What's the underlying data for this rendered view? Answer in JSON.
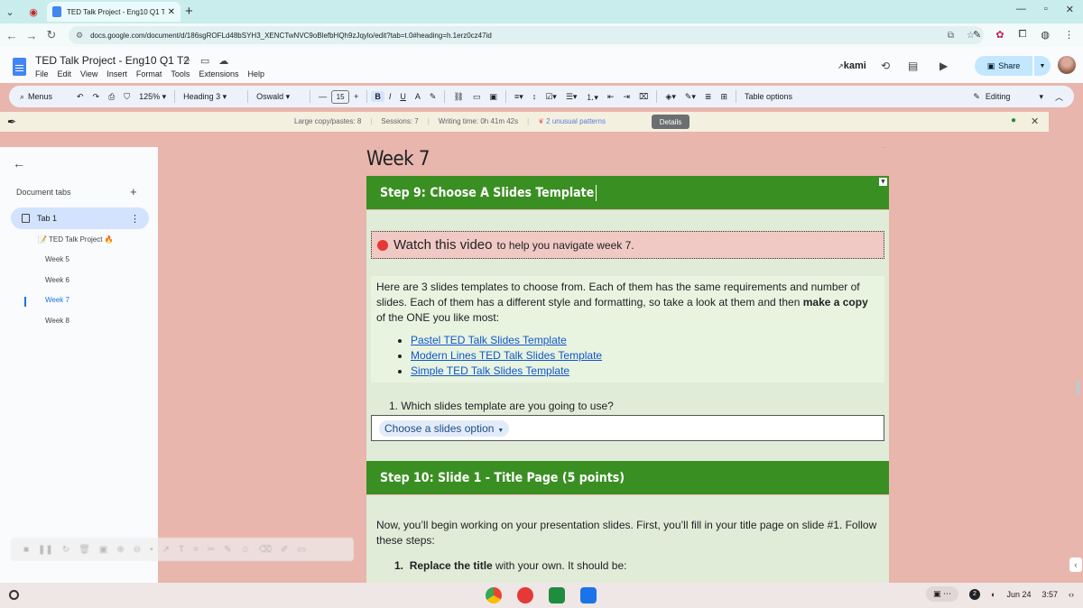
{
  "browser": {
    "tab_title": "TED Talk Project - Eng10 Q1 T2",
    "url": "docs.google.com/document/d/186sgROFLd48bSYH3_XENCTwNVC9oBlefbHQh9zJqylo/edit?tab=t.0#heading=h.1erz0cz47id"
  },
  "docs": {
    "title": "TED Talk Project - Eng10 Q1 T2",
    "menu": [
      "File",
      "Edit",
      "View",
      "Insert",
      "Format",
      "Tools",
      "Extensions",
      "Help"
    ],
    "kami_label": "kami",
    "share_label": "Share"
  },
  "toolbar": {
    "menus_label": "Menus",
    "zoom": "125%",
    "style": "Heading 3",
    "font": "Oswald",
    "font_size": "15",
    "table_options": "Table options",
    "mode": "Editing"
  },
  "banner": {
    "copy_pastes": "Large copy/pastes: 8",
    "sessions": "Sessions: 7",
    "writing_time": "Writing time: 0h 41m 42s",
    "unusual": "2 unusual patterns",
    "details": "Details"
  },
  "sidebar": {
    "tabs_label": "Document tabs",
    "tab1": "Tab 1",
    "outline": [
      {
        "label": "📝 TED Talk Project 🔥"
      },
      {
        "label": "Week 5"
      },
      {
        "label": "Week 6"
      },
      {
        "label": "Week 7"
      },
      {
        "label": "Week 8"
      }
    ]
  },
  "document": {
    "week_heading": "Week 7",
    "step9_title": "Step 9: Choose A Slides Template",
    "video_link": "Watch this video",
    "video_rest": "to help you navigate week 7.",
    "para_1": "Here are 3 slides templates to choose from. Each of them has the same requirements and number of slides. Each of them has a different style and formatting, so take a look at them and then ",
    "para_bold": "make a copy",
    "para_2": " of the ONE you like most:",
    "links": [
      "Pastel TED Talk Slides Template",
      "Modern Lines TED Talk Slides Template",
      "Simple TED Talk Slides Template"
    ],
    "question": "1.   Which slides template are you going to use?",
    "chip": "Choose a slides option",
    "step10_title": "Step 10: Slide 1 - Title Page (5 points)",
    "step10_text": "Now, you’ll begin working on your presentation slides. First, you’ll fill in your title page on slide #1. Follow these steps:",
    "step10_item_num": "1.",
    "step10_item_bold": "Replace the title",
    "step10_item_rest": " with your own. It should be:"
  },
  "shelf": {
    "date": "Jun 24",
    "time": "3:57",
    "notifications": "2"
  },
  "colors": {
    "step_bar": "#3a8f22",
    "content_bg": "#e0ecd8",
    "page_bg": "#e8b6ad",
    "link": "#1155cc"
  }
}
